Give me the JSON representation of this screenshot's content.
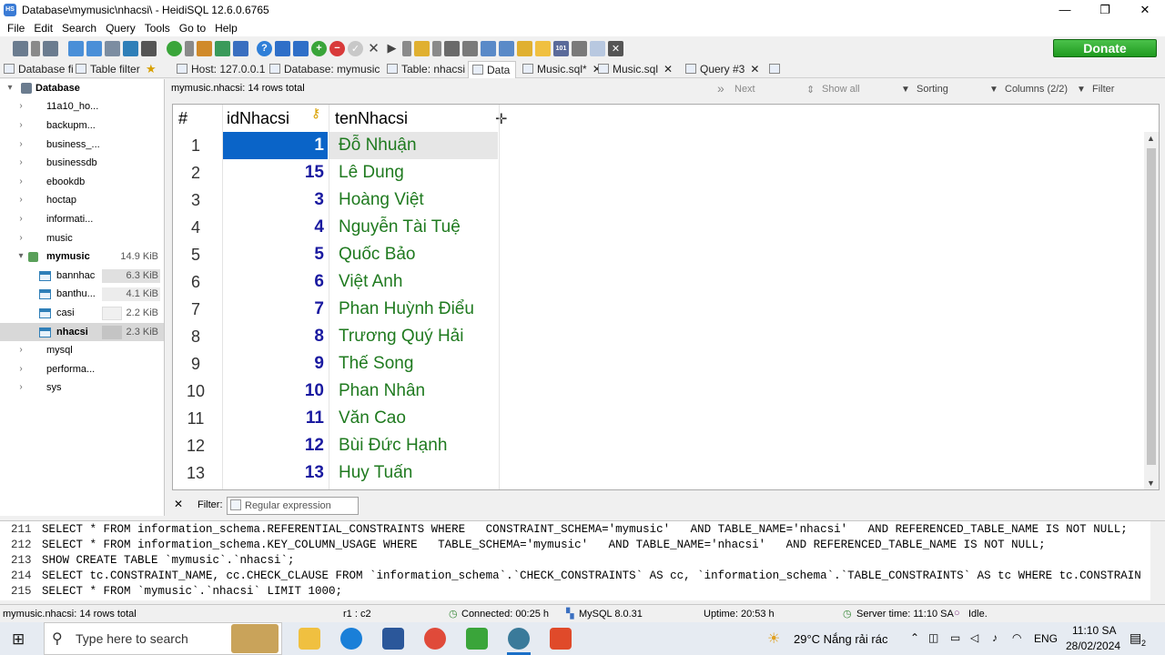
{
  "window": {
    "title": "Database\\mymusic\\nhacsi\\ - HeidiSQL 12.6.0.6765",
    "app_icon": "HS",
    "minimize": "—",
    "maximize": "❐",
    "close": "✕"
  },
  "menu": [
    "File",
    "Edit",
    "Search",
    "Query",
    "Tools",
    "Go to",
    "Help"
  ],
  "donate_label": "Donate",
  "tabs": {
    "db_filter": "Database fi",
    "table_filter": "Table filter",
    "host": "Host: 127.0.0.1",
    "database": "Database: mymusic",
    "table": "Table: nhacsi",
    "data": "Data",
    "music_sql_mod": "Music.sql*",
    "music_sql": "Music.sql",
    "query3": "Query #3"
  },
  "tree": {
    "root": "Database",
    "items": [
      {
        "label": "11a10_ho...",
        "size": ""
      },
      {
        "label": "backupm...",
        "size": ""
      },
      {
        "label": "business_...",
        "size": ""
      },
      {
        "label": "businessdb",
        "size": ""
      },
      {
        "label": "ebookdb",
        "size": ""
      },
      {
        "label": "hoctap",
        "size": ""
      },
      {
        "label": "informati...",
        "size": ""
      },
      {
        "label": "music",
        "size": ""
      },
      {
        "label": "mymusic",
        "size": "14.9 KiB"
      },
      {
        "label": "bannhac",
        "size": "6.3 KiB"
      },
      {
        "label": "banthu...",
        "size": "4.1 KiB"
      },
      {
        "label": "casi",
        "size": "2.2 KiB"
      },
      {
        "label": "nhacsi",
        "size": "2.3 KiB"
      },
      {
        "label": "mysql",
        "size": ""
      },
      {
        "label": "performa...",
        "size": ""
      },
      {
        "label": "sys",
        "size": ""
      }
    ]
  },
  "grid": {
    "summary": "mymusic.nhacsi: 14 rows total",
    "next": "Next",
    "show_all": "Show all",
    "sorting": "Sorting",
    "columns": "Columns (2/2)",
    "filter": "Filter",
    "headers": {
      "num": "#",
      "id": "idNhacsi",
      "name": "tenNhacsi"
    },
    "rows": [
      {
        "n": "1",
        "id": "1",
        "name": "Đỗ Nhuận"
      },
      {
        "n": "2",
        "id": "15",
        "name": "Lê Dung"
      },
      {
        "n": "3",
        "id": "3",
        "name": "Hoàng Việt"
      },
      {
        "n": "4",
        "id": "4",
        "name": "Nguyễn Tài Tuệ"
      },
      {
        "n": "5",
        "id": "5",
        "name": "Quốc Bảo"
      },
      {
        "n": "6",
        "id": "6",
        "name": "Việt Anh"
      },
      {
        "n": "7",
        "id": "7",
        "name": "Phan Huỳnh Điểu"
      },
      {
        "n": "8",
        "id": "8",
        "name": "Trương Quý Hải"
      },
      {
        "n": "9",
        "id": "9",
        "name": "Thế Song"
      },
      {
        "n": "10",
        "id": "10",
        "name": "Phan Nhân"
      },
      {
        "n": "11",
        "id": "11",
        "name": "Văn Cao"
      },
      {
        "n": "12",
        "id": "12",
        "name": "Bùi Đức Hạnh"
      },
      {
        "n": "13",
        "id": "13",
        "name": "Huy Tuấn"
      }
    ]
  },
  "filter": {
    "label": "Filter:",
    "placeholder": "Regular expression"
  },
  "sql_log": [
    {
      "ln": "211",
      "text": "SELECT * FROM information_schema.REFERENTIAL_CONSTRAINTS WHERE   CONSTRAINT_SCHEMA='mymusic'   AND TABLE_NAME='nhacsi'   AND REFERENCED_TABLE_NAME IS NOT NULL;"
    },
    {
      "ln": "212",
      "text": "SELECT * FROM information_schema.KEY_COLUMN_USAGE WHERE   TABLE_SCHEMA='mymusic'   AND TABLE_NAME='nhacsi'   AND REFERENCED_TABLE_NAME IS NOT NULL;"
    },
    {
      "ln": "213",
      "text": "SHOW CREATE TABLE `mymusic`.`nhacsi`;"
    },
    {
      "ln": "214",
      "text": "SELECT tc.CONSTRAINT_NAME, cc.CHECK_CLAUSE FROM `information_schema`.`CHECK_CONSTRAINTS` AS cc, `information_schema`.`TABLE_CONSTRAINTS` AS tc WHERE tc.CONSTRAIN"
    },
    {
      "ln": "215",
      "text": "SELECT * FROM `mymusic`.`nhacsi` LIMIT 1000;"
    }
  ],
  "status": {
    "left": "mymusic.nhacsi: 14 rows total",
    "pos": "r1 : c2",
    "connected": "Connected: 00:25 h",
    "server": "MySQL 8.0.31",
    "uptime": "Uptime: 20:53 h",
    "server_time": "Server time: 11:10 SA",
    "idle": "Idle."
  },
  "taskbar": {
    "search_placeholder": "Type here to search",
    "weather": "29°C  Nắng rải rác",
    "lang": "ENG",
    "time": "11:10 SA",
    "date": "28/02/2024",
    "notif": "2"
  }
}
